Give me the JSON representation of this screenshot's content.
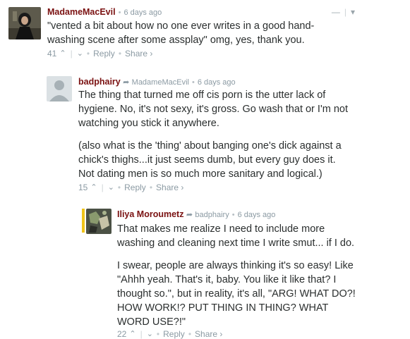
{
  "comments": [
    {
      "author": "MadameMacEvil",
      "time": "6 days ago",
      "body": [
        "\"vented a bit about how no one ever writes in a good hand-washing scene after some assplay\" omg, yes, thank you."
      ],
      "votes": "41",
      "reply_label": "Reply",
      "share_label": "Share ›",
      "collapse_label": "—",
      "menu_label": "▾"
    },
    {
      "author": "badphairy",
      "reply_to": "MadameMacEvil",
      "time": "6 days ago",
      "body": [
        "The thing that turned me off cis porn is the utter lack of hygiene. No, it's not sexy, it's gross. Go wash that or I'm not watching you stick it anywhere.",
        "(also what is the 'thing' about banging one's dick against a chick's thighs...it just seems dumb, but every guy does it. Not dating men is so much more sanitary and logical.)"
      ],
      "votes": "15",
      "reply_label": "Reply",
      "share_label": "Share ›"
    },
    {
      "author": "Iliya Moroumetz",
      "reply_to": "badphairy",
      "time": "6 days ago",
      "body": [
        "That makes me realize I need to include more washing and cleaning next time I write smut... if I do.",
        "I swear, people are always thinking it's so easy! Like \"Ahhh yeah. That's it, baby. You like it like that? I thought so.\", but in reality, it's all, \"ARG! WHAT DO?! HOW WORK!? PUT THING IN THING? WHAT WORD USE?!\""
      ],
      "votes": "22",
      "reply_label": "Reply",
      "share_label": "Share ›"
    }
  ]
}
